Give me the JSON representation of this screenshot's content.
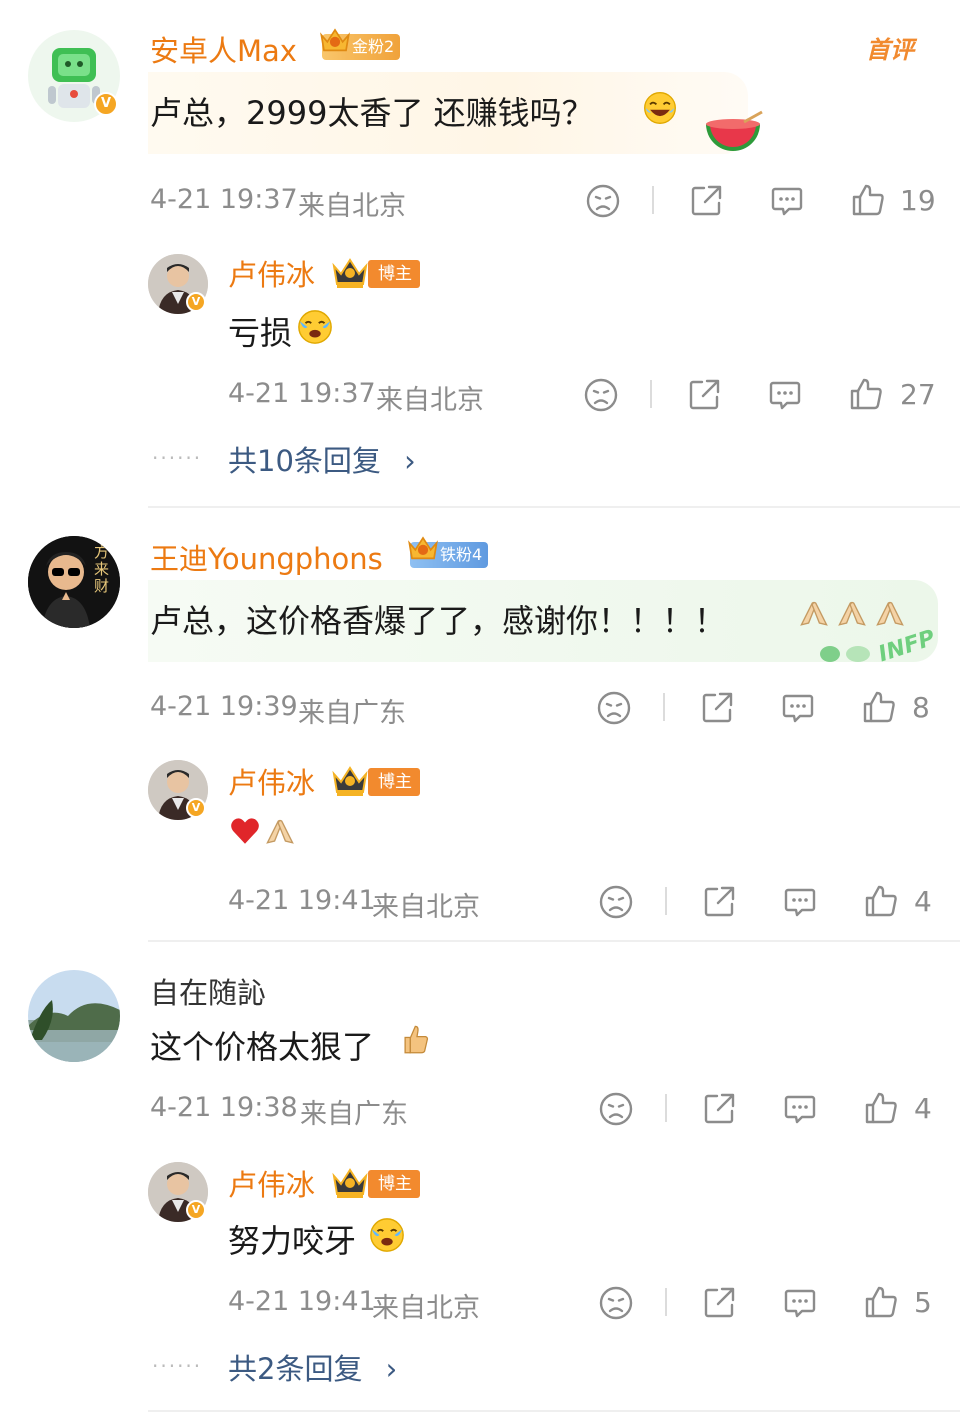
{
  "comments": [
    {
      "name": "安卓人Max",
      "badge": "金粉2",
      "badge_level": "5",
      "tag": "首评",
      "text": "卢总，2999太香了 还赚钱吗？",
      "time": "4-21 19:37",
      "location": "来自北京",
      "likes": "19",
      "reply": {
        "name": "卢伟冰",
        "badge": "博主",
        "text": "亏损",
        "time": "4-21 19:37",
        "location": "来自北京",
        "likes": "27"
      },
      "more_replies": "共10条回复"
    },
    {
      "name": "王迪Youngphons",
      "badge": "铁粉4",
      "badge_level": "2",
      "avatar_text": "方来财",
      "text": "卢总，这价格香爆了了，感谢你！！！！",
      "time": "4-21 19:39",
      "location": "来自广东",
      "likes": "8",
      "bubble_tag": "INFP",
      "reply": {
        "name": "卢伟冰",
        "badge": "博主",
        "text": "",
        "time": "4-21 19:41",
        "location": "来自北京",
        "likes": "4"
      }
    },
    {
      "name": "自在随訫",
      "text": "这个价格太狠了",
      "time": "4-21 19:38",
      "location": "来自广东",
      "likes": "4",
      "reply": {
        "name": "卢伟冰",
        "badge": "博主",
        "text": "努力咬牙",
        "time": "4-21 19:41",
        "location": "来自北京",
        "likes": "5"
      },
      "more_replies": "共2条回复"
    }
  ],
  "colors": {
    "name": "#ec7a12",
    "link": "#3c5a82",
    "meta": "#8c8c8c"
  }
}
